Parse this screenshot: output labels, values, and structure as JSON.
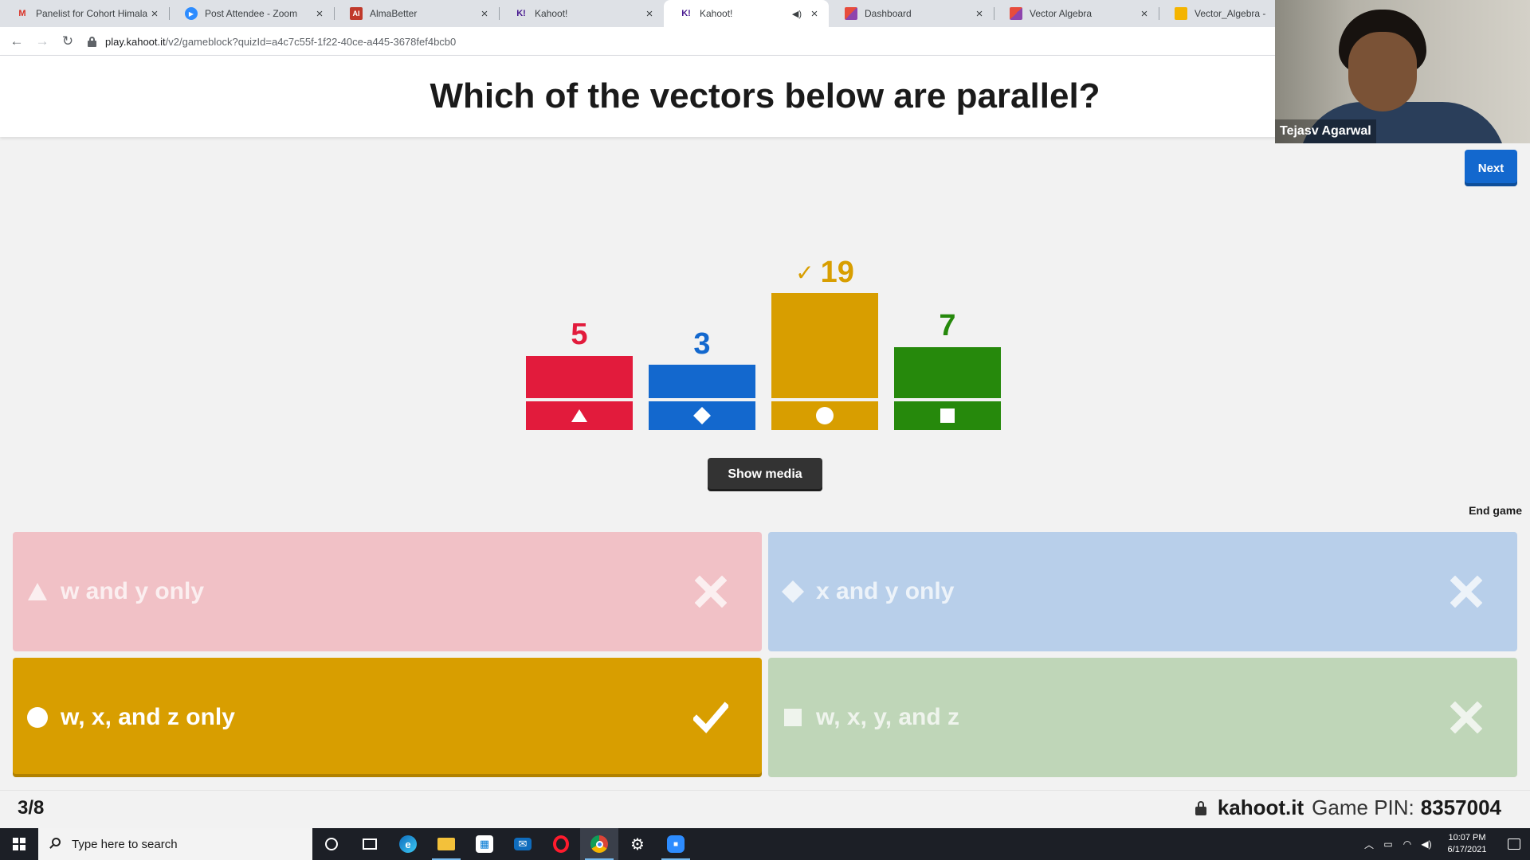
{
  "browser": {
    "tabs": [
      {
        "title": "Panelist for Cohort Himala",
        "favicon": "gmail-icon"
      },
      {
        "title": "Post Attendee - Zoom",
        "favicon": "zoom-icon"
      },
      {
        "title": "AlmaBetter",
        "favicon": "almabetter-icon"
      },
      {
        "title": "Kahoot!",
        "favicon": "kahoot-icon"
      },
      {
        "title": "Kahoot!",
        "favicon": "kahoot-icon",
        "active": true,
        "audio": true
      },
      {
        "title": "Dashboard",
        "favicon": "dashboard-icon"
      },
      {
        "title": "Vector Algebra",
        "favicon": "vector-icon"
      },
      {
        "title": "Vector_Algebra - Goo",
        "favicon": "slides-icon"
      }
    ],
    "url_host": "play.kahoot.it",
    "url_path": "/v2/gameblock?quizId=a4c7c55f-1f22-40ce-a445-3678fef4bcb0"
  },
  "question": {
    "text": "Which of the vectors below are parallel?"
  },
  "video": {
    "participant_name": "Tejasv Agarwal"
  },
  "controls": {
    "next_label": "Next",
    "show_media_label": "Show media",
    "end_game_label": "End game"
  },
  "chart_data": {
    "type": "bar",
    "categories": [
      "triangle",
      "diamond",
      "circle",
      "square"
    ],
    "values": [
      5,
      3,
      19,
      7
    ],
    "colors": [
      "#e21b3c",
      "#1368ce",
      "#d89e00",
      "#26890c"
    ],
    "correct_index": 2,
    "check_mark": "✓"
  },
  "answers": [
    {
      "text": "w and y only",
      "shape": "triangle",
      "color": "#e21b3c",
      "bg": "#f1c1c6",
      "correct": false
    },
    {
      "text": "x and y only",
      "shape": "diamond",
      "color": "#1368ce",
      "bg": "#b8cfea",
      "correct": false
    },
    {
      "text": "w, x, and z only",
      "shape": "circle",
      "color": "#d89e00",
      "bg": "#d89e00",
      "correct": true
    },
    {
      "text": "w, x, y, and z",
      "shape": "square",
      "color": "#26890c",
      "bg": "#bfd6b8",
      "correct": false
    }
  ],
  "footer": {
    "progress": "3/8",
    "host": "kahoot.it",
    "pin_label": "Game PIN:",
    "pin": "8357004"
  },
  "taskbar": {
    "search_placeholder": "Type here to search",
    "time": "10:07 PM",
    "date": "6/17/2021"
  }
}
